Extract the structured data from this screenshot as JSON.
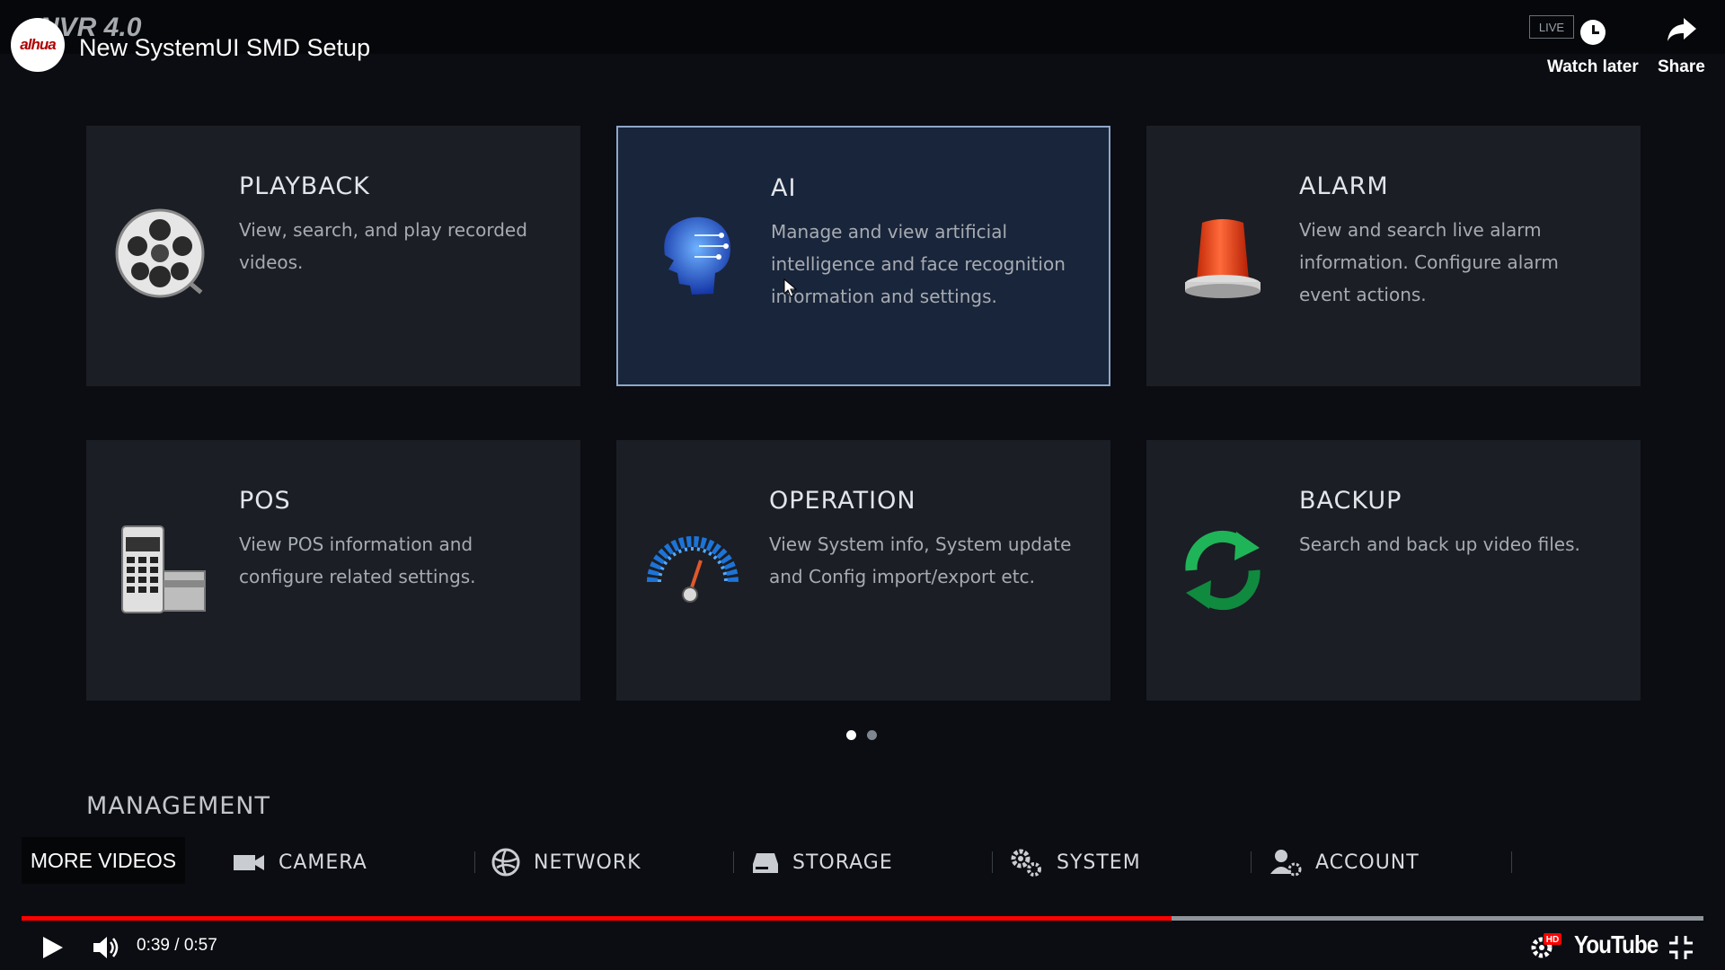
{
  "header": {
    "channel_logo_text": "alhua",
    "nvr_ghost_text": "NVR 4.0",
    "video_title": "New SystemUI SMD Setup",
    "live_label": "LIVE",
    "watch_later_label": "Watch later",
    "share_label": "Share"
  },
  "cards": [
    {
      "title": "PLAYBACK",
      "description": "View, search, and play recorded videos.",
      "icon": "film-reel-icon"
    },
    {
      "title": "AI",
      "description": "Manage and view artificial intelligence and face recognition information and settings.",
      "icon": "ai-brain-icon"
    },
    {
      "title": "ALARM",
      "description": "View and search live alarm information. Configure alarm event actions.",
      "icon": "alarm-siren-icon"
    },
    {
      "title": "POS",
      "description": "View POS information and configure related settings.",
      "icon": "pos-terminal-icon"
    },
    {
      "title": "OPERATION",
      "description": "View System info, System update and Config import/export etc.",
      "icon": "gauge-icon"
    },
    {
      "title": "BACKUP",
      "description": "Search and back up video files.",
      "icon": "backup-refresh-icon"
    }
  ],
  "selected_card": "AI",
  "pagination": {
    "current_page": 1,
    "total_pages": 2
  },
  "management": {
    "heading": "MANAGEMENT",
    "items": [
      {
        "label": "CAMERA",
        "icon": "camera-icon"
      },
      {
        "label": "NETWORK",
        "icon": "network-globe-icon"
      },
      {
        "label": "STORAGE",
        "icon": "storage-drive-icon"
      },
      {
        "label": "SYSTEM",
        "icon": "system-gears-icon"
      },
      {
        "label": "ACCOUNT",
        "icon": "account-user-icon"
      }
    ]
  },
  "player": {
    "more_videos_label": "MORE VIDEOS",
    "time_display": "0:39 / 0:57",
    "progress_fraction": 0.684,
    "brand": "YouTube",
    "quality_badge": "HD"
  },
  "colors": {
    "background": "#0b0d12",
    "card_bg": "#1b1e25",
    "card_selected_bg": "#19253a",
    "card_selected_border": "#8ea7c7",
    "progress_red": "#ff0000"
  }
}
